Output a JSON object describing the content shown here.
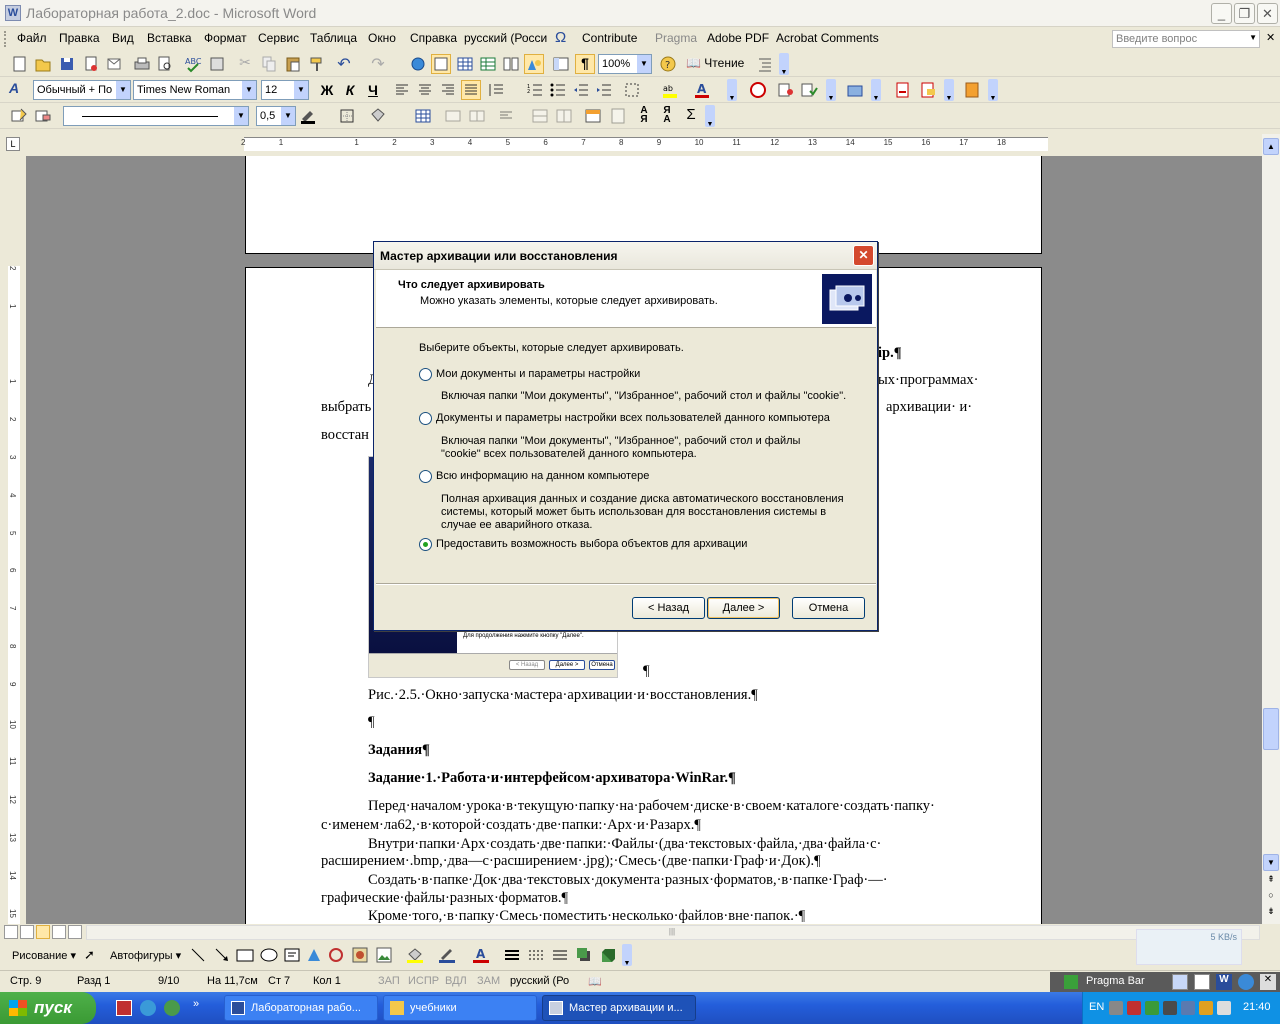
{
  "window": {
    "title": "Лабораторная работа_2.doc - Microsoft Word"
  },
  "menu": [
    "Файл",
    "Правка",
    "Вид",
    "Вставка",
    "Формат",
    "Сервис",
    "Таблица",
    "Окно",
    "Справка"
  ],
  "menu_extra": {
    "language": "русский (Росси",
    "contribute": "Contribute",
    "pragma": "Pragma",
    "adobe": "Adobe PDF",
    "acrobat": "Acrobat Comments",
    "help_placeholder": "Введите вопрос"
  },
  "toolbar": {
    "zoom": "100%",
    "read": "Чтение",
    "style": "Обычный + По ц",
    "font": "Times New Roman",
    "size": "12",
    "bold": "Ж",
    "italic": "К",
    "underline": "Ч",
    "line_weight": "0,5"
  },
  "ruler": {
    "ticks": [
      "2",
      "1",
      "",
      "1",
      "2",
      "3",
      "4",
      "5",
      "6",
      "7",
      "8",
      "9",
      "10",
      "11",
      "12",
      "13",
      "14",
      "15",
      "16",
      "17",
      "18"
    ]
  },
  "document": {
    "caption": "Рис.·2.5.·Окно·запуска·мастера·архивации·и·восстановления.¶",
    "empty_para": "¶",
    "tasks_heading": "Задания¶",
    "task1_heading": "Задание·1.·Работа·и·интерфейсом·архиватора·WinRar.¶",
    "p1_line1": "Перед·началом·урока·в·текущую·папку·на·рабочем·диске·в·своем·каталоге·создать·папку·",
    "p1_line2": "с·именем·ла62,·в·которой·создать·две·папки:·Арх·и·Разарх.¶",
    "p2_line1": "Внутри·папки·Арх·создать·две·папки:·Файлы·(два·текстовых·файла,·два·файла·с·",
    "p2_line2": "расширением·.bmp,·два—с·расширением·.jpg);·Смесь·(две·папки·Граф·и·Док).¶",
    "p3_line1": "Создать·в·папке·Док·два·текстовых·документа·разных·форматов,·в·папке·Граф·—·",
    "p3_line2": "графические·файлы·разных·форматов.¶",
    "p4_line1": "Кроме·того,·в·папку·Смесь·поместить·несколько·файлов·вне·папок.·¶",
    "behind_right1": "ip.¶",
    "behind_left1": "Д",
    "behind_right2": "ых·программах·",
    "behind_left2": "выбрать",
    "behind_right3": "архивации·  и·",
    "behind_left3": "восстан",
    "screenshot_hint": "Для продолжения нажмите кнопку \"Далее\".",
    "screenshot_back": "< Назад",
    "screenshot_next": "Далее >",
    "screenshot_cancel": "Отмена",
    "screenshot_pilcrow": "¶"
  },
  "dialog": {
    "title": "Мастер архивации или восстановления",
    "heading": "Что следует архивировать",
    "subheading": "Можно указать элементы, которые следует архивировать.",
    "prompt": "Выберите объекты, которые следует архивировать.",
    "options": [
      {
        "label": "Мои документы и параметры настройки",
        "desc1": "Включая папки \"Мои документы\", \"Избранное\", рабочий стол и файлы \"cookie\".",
        "desc2": "",
        "desc3": "",
        "selected": false
      },
      {
        "label": "Документы и параметры настройки всех пользователей данного компьютера",
        "desc1": "Включая папки \"Мои документы\", \"Избранное\", рабочий стол и файлы",
        "desc2": "\"cookie\" всех пользователей данного компьютера.",
        "desc3": "",
        "selected": false
      },
      {
        "label": "Всю информацию на данном компьютере",
        "desc1": "Полная архивация данных и создание диска автоматического восстановления",
        "desc2": "системы, который может быть использован для восстановления системы в",
        "desc3": "случае ее аварийного отказа.",
        "selected": false
      },
      {
        "label": "Предоставить возможность выбора объектов для архивации",
        "desc1": "",
        "desc2": "",
        "desc3": "",
        "selected": true
      }
    ],
    "back": "< Назад",
    "next": "Далее >",
    "cancel": "Отмена",
    "close": "✕"
  },
  "drawing_toolbar": {
    "draw": "Рисование ▾",
    "autoshapes": "Автофигуры ▾"
  },
  "statusbar": {
    "page": "Стр. 9",
    "section": "Разд 1",
    "pages": "9/10",
    "position": "На 11,7см",
    "line": "Ст 7",
    "column": "Кол 1",
    "rec": "ЗАП",
    "trk": "ИСПР",
    "ext": "ВДЛ",
    "ovr": "ЗАМ",
    "lang": "русский (Ро",
    "pragma_bar": "Pragma Bar",
    "speed": "5 KB/s"
  },
  "taskbar": {
    "start": "пуск",
    "tasks": [
      "Лабораторная рабо...",
      "учебники",
      "Мастер архивации и..."
    ],
    "lang": "EN",
    "time": "21:40"
  },
  "colors": {
    "taskbar": "#245edb",
    "start": "#3a9a34",
    "dialog_border": "#0a246a",
    "close_button": "#d4492e"
  }
}
